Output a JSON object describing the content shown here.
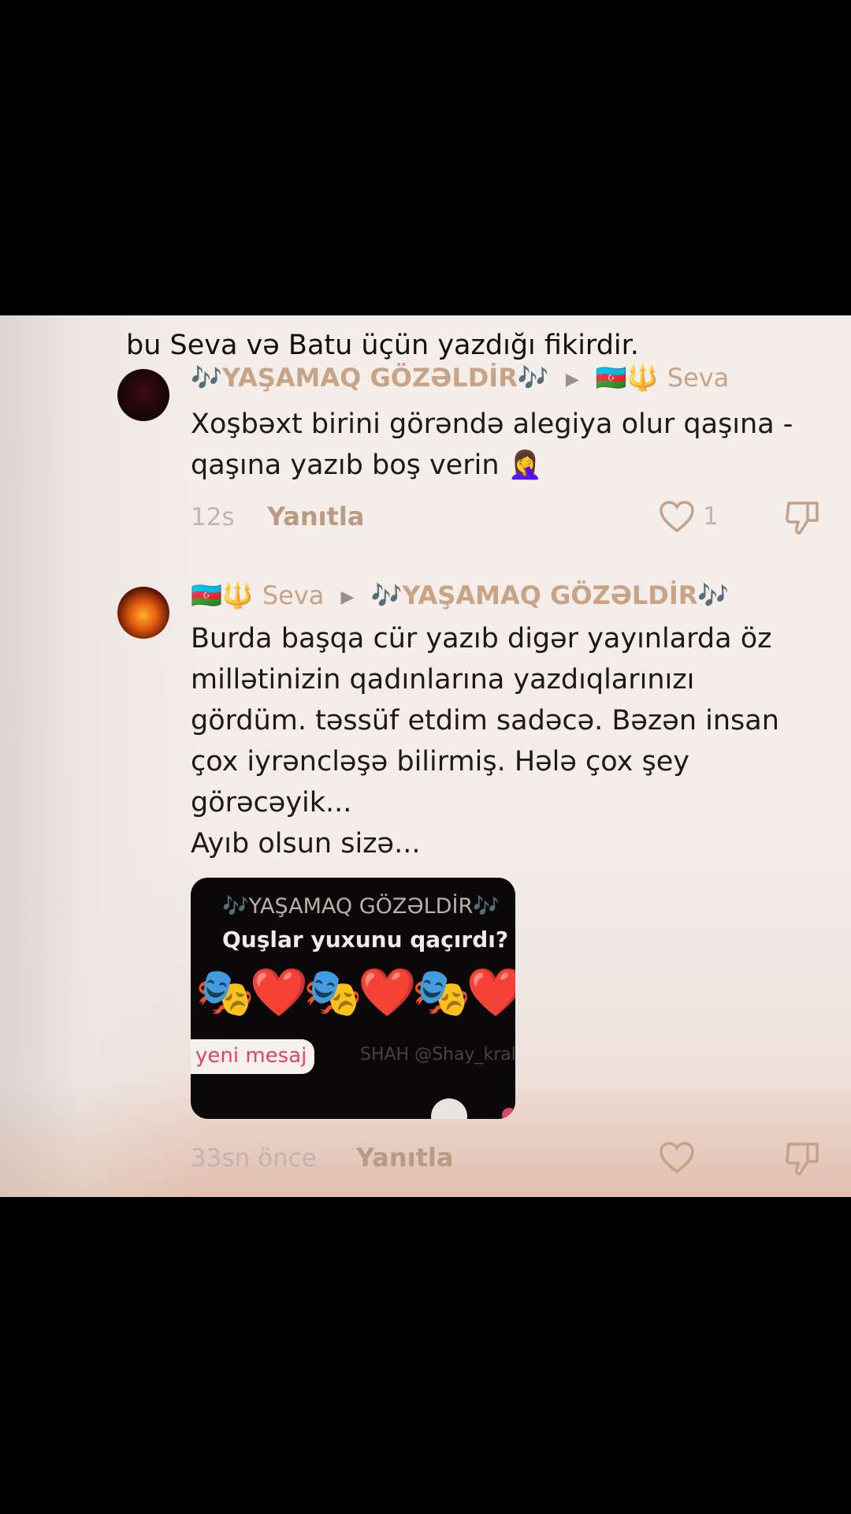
{
  "overlay_caption": "bu Seva və Batu üçün yazdığı fikirdir.",
  "comments": [
    {
      "author": "🎶YAŞAMAQ GÖZƏLDİR🎶",
      "reply_to_flag": "🇦🇿🔱",
      "reply_to_name": "Seva",
      "text": "Xoşbəxt birini görəndə alegiya olur qaşına -qaşına yazıb boş verin 🤦‍♀️",
      "time": "12s",
      "reply_label": "Yanıtla",
      "likes": "1"
    },
    {
      "author_flag": "🇦🇿🔱",
      "author_name": "Seva",
      "reply_to": "🎶YAŞAMAQ GÖZƏLDİR🎶",
      "text_lines": [
        "Burda başqa cür yazıb digər yayınlarda öz millətinizin qadınlarına yazdıqlarınızı gördüm. təssüf etdim sadəcə. Bəzən insan çox iyrəncləşə bilirmiş. Hələ çox şey görəcəyik...",
        "Ayıb olsun sizə..."
      ],
      "attachment": {
        "title": "🎶YAŞAMAQ GÖZƏLDİR🎶",
        "question": "Quşlar yuxunu qaçırdı?",
        "emojis": "🎭❤️🎭❤️🎭❤️🎭",
        "new_message": "yeni mesaj",
        "faint_text": "SHAH @Shay_kral"
      },
      "time": "33sn önce",
      "reply_label": "Yanıtla",
      "likes": ""
    }
  ],
  "icons": {
    "like": "heart-outline-icon",
    "dislike": "thumbs-down-outline-icon",
    "triangle": "play-triangle-icon"
  },
  "colors": {
    "username": "#c8a386",
    "reply": "#b99a85",
    "muted": "#bdb5b0",
    "text": "#1a1a1a"
  }
}
